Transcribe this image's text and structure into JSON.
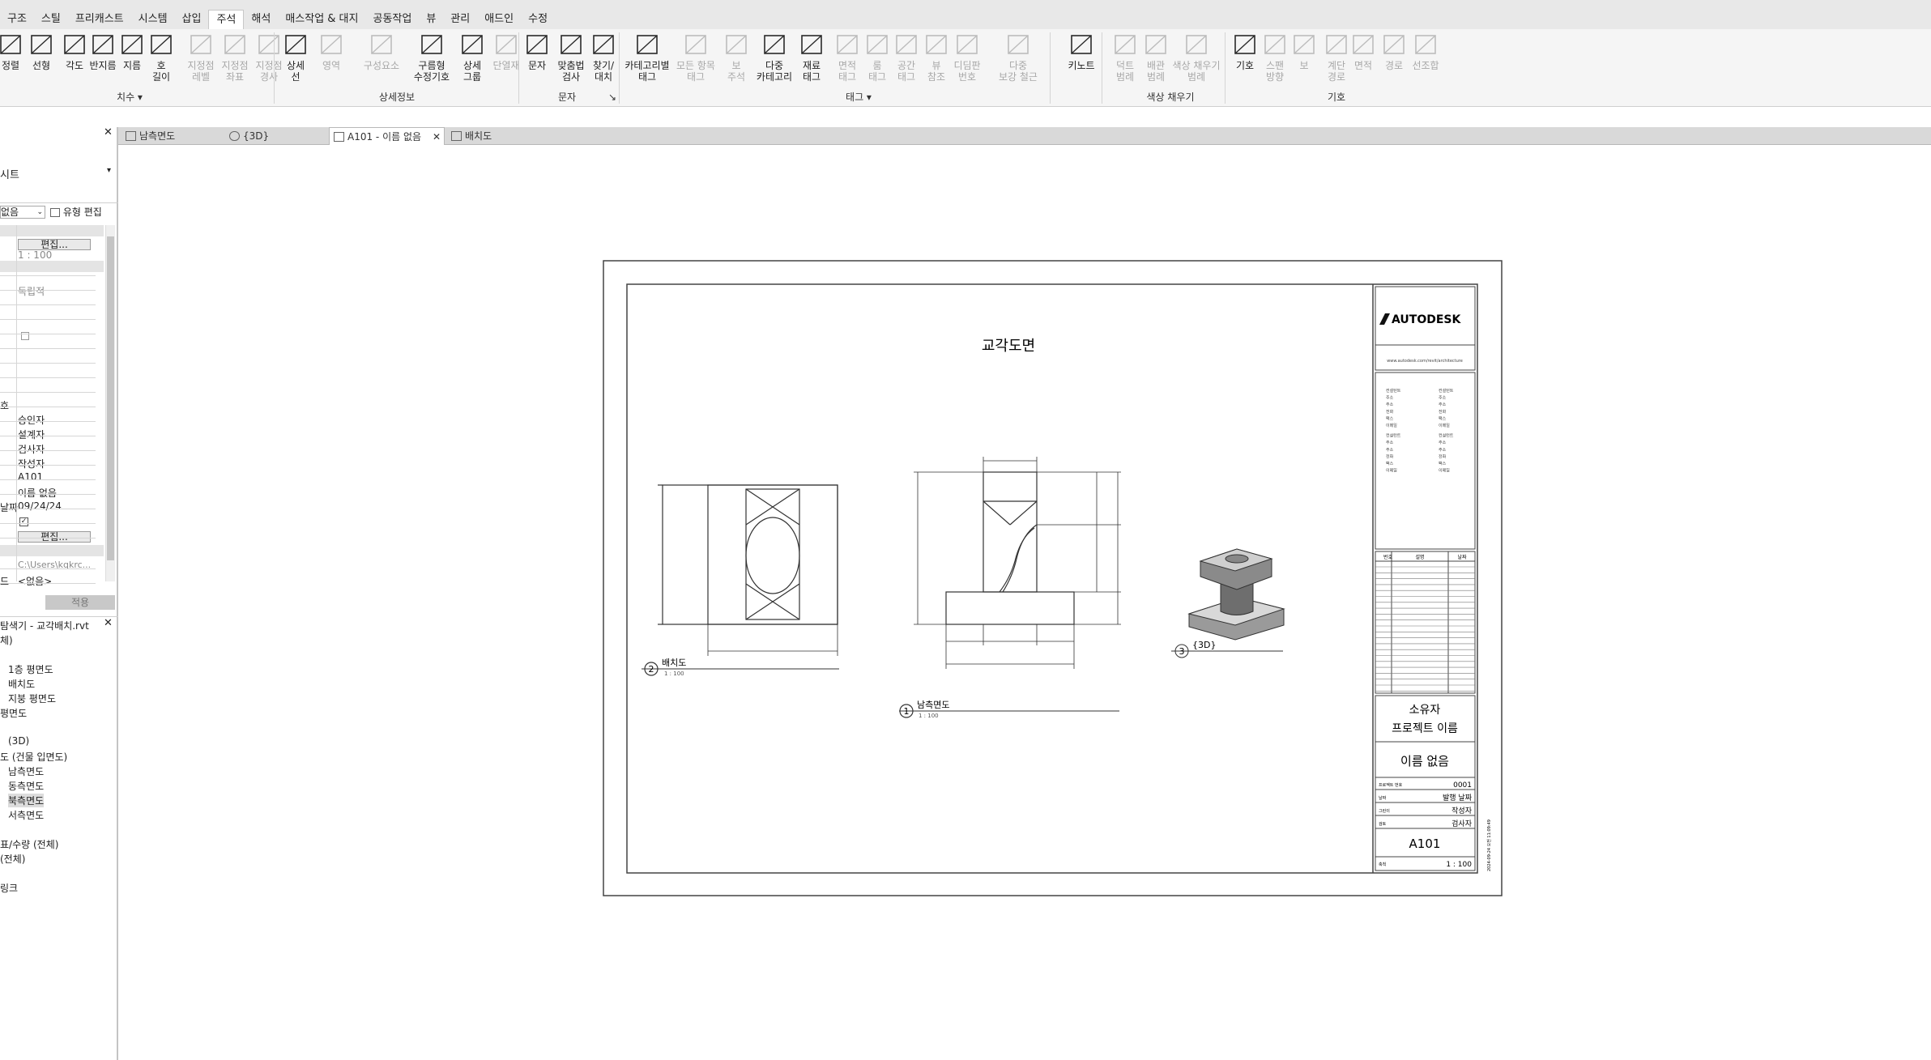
{
  "menu": {
    "items": [
      "구조",
      "스틸",
      "프리캐스트",
      "시스템",
      "삽입",
      "주석",
      "해석",
      "매스작업 & 대지",
      "공동작업",
      "뷰",
      "관리",
      "애드인",
      "수정"
    ],
    "active": "주석"
  },
  "ribbon": {
    "buttons": [
      {
        "label": "정렬",
        "dim": false
      },
      {
        "label": "선형",
        "dim": false
      },
      {
        "label": "각도",
        "dim": false
      },
      {
        "label": "반지름",
        "dim": false
      },
      {
        "label": "지름",
        "dim": false
      },
      {
        "label": "호\n길이",
        "dim": false
      },
      {
        "label": "지정점\n레벨",
        "dim": true
      },
      {
        "label": "지정점\n좌표",
        "dim": true
      },
      {
        "label": "지정점\n경사",
        "dim": true
      },
      {
        "label": "상세\n선",
        "dim": false
      },
      {
        "label": "영역",
        "dim": true
      },
      {
        "label": "구성요소",
        "dim": true
      },
      {
        "label": "구름형\n수정기호",
        "dim": false
      },
      {
        "label": "상세\n그룹",
        "dim": false
      },
      {
        "label": "단열재",
        "dim": true
      },
      {
        "label": "문자",
        "dim": false
      },
      {
        "label": "맞춤법\n검사",
        "dim": false
      },
      {
        "label": "찾기/\n대치",
        "dim": false
      },
      {
        "label": "카테고리별\n태그",
        "dim": false
      },
      {
        "label": "모든 항목\n태그",
        "dim": true
      },
      {
        "label": "보\n주석",
        "dim": true
      },
      {
        "label": "다중\n카테고리",
        "dim": false
      },
      {
        "label": "재료\n태그",
        "dim": false
      },
      {
        "label": "면적\n태그",
        "dim": true
      },
      {
        "label": "룸\n태그",
        "dim": true
      },
      {
        "label": "공간\n태그",
        "dim": true
      },
      {
        "label": "뷰\n참조",
        "dim": true
      },
      {
        "label": "디딤판\n번호",
        "dim": true
      },
      {
        "label": "다중\n보강 철근",
        "dim": true
      },
      {
        "label": "키노트",
        "dim": false
      },
      {
        "label": "덕트\n범례",
        "dim": true
      },
      {
        "label": "배관\n범례",
        "dim": true
      },
      {
        "label": "색상 채우기\n범례",
        "dim": true
      },
      {
        "label": "기호",
        "dim": false
      },
      {
        "label": "스팬\n방향",
        "dim": true
      },
      {
        "label": "보",
        "dim": true
      },
      {
        "label": "계단\n경로",
        "dim": true
      },
      {
        "label": "면적",
        "dim": true
      },
      {
        "label": "경로",
        "dim": true
      },
      {
        "label": "선조합",
        "dim": true
      }
    ],
    "panels": {
      "dimension": "치수 ▾",
      "detail": "상세정보",
      "text": "문자",
      "text_more": "↘",
      "tag": "태그 ▾",
      "color_fill": "색상 채우기",
      "symbol": "기호"
    }
  },
  "tabs": [
    {
      "label": "남측면도",
      "active": false
    },
    {
      "label": "{3D}",
      "active": false
    },
    {
      "label": "A101 - 이름 없음",
      "active": true
    },
    {
      "label": "배치도",
      "active": false
    }
  ],
  "tab_close": "✕",
  "properties": {
    "close": "✕",
    "type_name": "시트",
    "selector_value": "없음",
    "edit_type": "유형 편집",
    "rows_top": [
      "편집...",
      "1 : 100"
    ],
    "independent": "독립적",
    "identity": [
      "승인자",
      "설계자",
      "검사자",
      "작성자",
      "A101",
      "이름 없음",
      "09/24/24"
    ],
    "label_day": "날짜",
    "label_ho": "호",
    "label_do": "드",
    "edit_btn": "편집...",
    "path": "C:\\Users\\kqkrc...",
    "none": "<없음>",
    "apply": "적용"
  },
  "browser": {
    "title": "탐색기 - 교각배치.rvt",
    "items": [
      "체)",
      "1층 평면도",
      "배치도",
      "지붕 평면도",
      "평면도",
      "(3D)",
      "도 (건물 입면도)",
      "남측면도",
      "동측면도",
      "북측면도",
      "서측면도",
      "표/수량 (전체)",
      "(전체)",
      "링크"
    ]
  },
  "sheet": {
    "title": "교각도면",
    "views": [
      {
        "number": "2",
        "name": "배치도",
        "scale": "1 : 100"
      },
      {
        "number": "1",
        "name": "남측면도",
        "scale": "1 : 100"
      },
      {
        "number": "3",
        "name": "{3D}",
        "scale": ""
      }
    ],
    "titleblock": {
      "brand": "AUTODESK",
      "url": "www.autodesk.com/revit/architecture",
      "consultants_left": [
        "컨설턴트",
        "주소",
        "주소",
        "전화",
        "팩스",
        "이메일",
        "컨설턴트",
        "주소",
        "주소",
        "전화",
        "팩스",
        "이메일"
      ],
      "consultants_right": [
        "컨설턴트",
        "주소",
        "주소",
        "전화",
        "팩스",
        "이메일",
        "컨설턴트",
        "주소",
        "주소",
        "전화",
        "팩스",
        "이메일"
      ],
      "rev_headers": [
        "번호",
        "설명",
        "날짜"
      ],
      "owner": "소유자",
      "project": "프로젝트 이름",
      "sheet_name": "이름 없음",
      "info": [
        {
          "label": "프로젝트 번호",
          "value": "0001"
        },
        {
          "label": "날짜",
          "value": "발행 날짜"
        },
        {
          "label": "그린이",
          "value": "작성자"
        },
        {
          "label": "검토",
          "value": "검사자"
        }
      ],
      "sheet_number": "A101",
      "scale_label": "축척",
      "scale": "1 : 100",
      "side_text": "2024-09-24 오전 11:09:49"
    }
  }
}
